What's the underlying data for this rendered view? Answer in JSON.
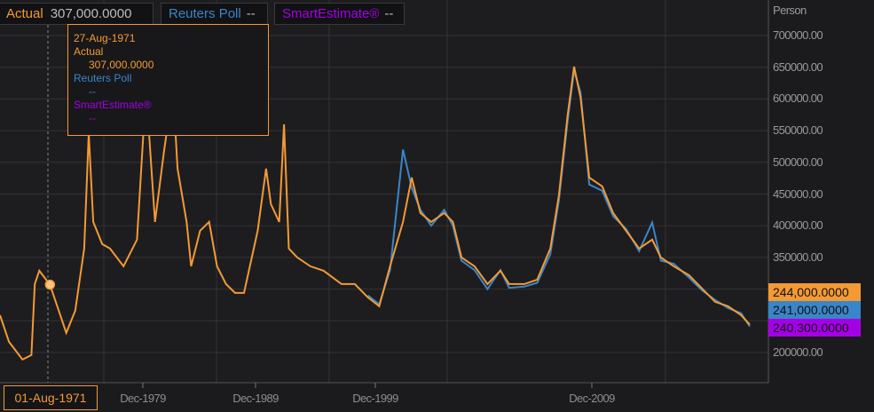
{
  "legend": {
    "actual_label": "Actual",
    "actual_value": "307,000.0000",
    "reuters_label": "Reuters Poll",
    "reuters_value": "--",
    "smart_label": "SmartEstimate®",
    "smart_value": "--"
  },
  "tooltip": {
    "date": "27-Aug-1971",
    "actual_label": "Actual",
    "actual_value": "307,000.0000",
    "reuters_label": "Reuters Poll",
    "reuters_value": "--",
    "smart_label": "SmartEstimate®",
    "smart_value": "--"
  },
  "cursor_date": "01-Aug-1971",
  "colors": {
    "actual": "#f39a35",
    "reuters": "#3a85c8",
    "smart": "#a400e6"
  },
  "chart_data": {
    "type": "line",
    "y_unit": "Person",
    "ylim": [
      150000,
      720000
    ],
    "y_ticks": [
      "700000.00",
      "650000.00",
      "600000.00",
      "550000.00",
      "500000.00",
      "450000.00",
      "400000.00",
      "350000.00",
      "200000.00"
    ],
    "x_ticks": [
      "Dec-1979",
      "Dec-1989",
      "Dec-1999",
      "Dec-2009"
    ],
    "last_values": {
      "actual": "244,000.0000",
      "reuters": "241,000.0000",
      "smart": "240,300.0000"
    },
    "series": [
      {
        "name": "Actual",
        "points": [
          [
            1967.2,
            259000
          ],
          [
            1968.0,
            217000
          ],
          [
            1969.2,
            189000
          ],
          [
            1970.0,
            196000
          ],
          [
            1970.3,
            308000
          ],
          [
            1970.7,
            329000
          ],
          [
            1971.65,
            307000
          ],
          [
            1973.1,
            231000
          ],
          [
            1973.9,
            266000
          ],
          [
            1974.7,
            364000
          ],
          [
            1975.1,
            546000
          ],
          [
            1975.5,
            406000
          ],
          [
            1976.3,
            371000
          ],
          [
            1977.0,
            364000
          ],
          [
            1978.2,
            336000
          ],
          [
            1979.4,
            378000
          ],
          [
            1980.2,
            616000
          ],
          [
            1981.0,
            406000
          ],
          [
            1981.8,
            518000
          ],
          [
            1982.6,
            616000
          ],
          [
            1983.0,
            490000
          ],
          [
            1983.8,
            406000
          ],
          [
            1984.2,
            336000
          ],
          [
            1985.0,
            392000
          ],
          [
            1985.8,
            406000
          ],
          [
            1986.5,
            336000
          ],
          [
            1987.3,
            308000
          ],
          [
            1988.1,
            294000
          ],
          [
            1988.9,
            294000
          ],
          [
            1990.1,
            392000
          ],
          [
            1990.8,
            490000
          ],
          [
            1991.2,
            434000
          ],
          [
            1991.9,
            406000
          ],
          [
            1992.3,
            560000
          ],
          [
            1992.7,
            364000
          ],
          [
            1993.4,
            350000
          ],
          [
            1994.5,
            336000
          ],
          [
            1995.6,
            329000
          ],
          [
            1997.1,
            308000
          ],
          [
            1998.2,
            308000
          ],
          [
            1999.3,
            287000
          ],
          [
            2000.1,
            273000
          ],
          [
            2000.6,
            336000
          ],
          [
            2001.2,
            406000
          ],
          [
            2001.6,
            476000
          ],
          [
            2002.0,
            420000
          ],
          [
            2002.5,
            406000
          ],
          [
            2003.1,
            420000
          ],
          [
            2003.5,
            406000
          ],
          [
            2003.9,
            350000
          ],
          [
            2004.5,
            336000
          ],
          [
            2005.1,
            308000
          ],
          [
            2005.7,
            329000
          ],
          [
            2006.1,
            308000
          ],
          [
            2006.8,
            308000
          ],
          [
            2007.4,
            315000
          ],
          [
            2008.0,
            364000
          ],
          [
            2008.4,
            448000
          ],
          [
            2008.8,
            574000
          ],
          [
            2009.1,
            651000
          ],
          [
            2009.4,
            602000
          ],
          [
            2009.8,
            476000
          ],
          [
            2010.4,
            462000
          ],
          [
            2010.9,
            420000
          ],
          [
            2011.5,
            392000
          ],
          [
            2012.1,
            364000
          ],
          [
            2012.7,
            378000
          ],
          [
            2013.1,
            350000
          ],
          [
            2013.7,
            336000
          ],
          [
            2014.4,
            322000
          ],
          [
            2015.0,
            301000
          ],
          [
            2015.6,
            280000
          ],
          [
            2016.2,
            273000
          ],
          [
            2016.8,
            259000
          ],
          [
            2017.2,
            244000
          ]
        ]
      },
      {
        "name": "Reuters Poll",
        "points": [
          [
            1999.3,
            290000
          ],
          [
            2000.1,
            276000
          ],
          [
            2000.6,
            330000
          ],
          [
            2001.2,
            520000
          ],
          [
            2001.6,
            460000
          ],
          [
            2002.0,
            425000
          ],
          [
            2002.5,
            400000
          ],
          [
            2003.1,
            425000
          ],
          [
            2003.5,
            400000
          ],
          [
            2003.9,
            345000
          ],
          [
            2004.5,
            330000
          ],
          [
            2005.1,
            300000
          ],
          [
            2005.7,
            330000
          ],
          [
            2006.1,
            302000
          ],
          [
            2006.8,
            304000
          ],
          [
            2007.4,
            310000
          ],
          [
            2008.0,
            355000
          ],
          [
            2008.4,
            440000
          ],
          [
            2008.8,
            565000
          ],
          [
            2009.1,
            645000
          ],
          [
            2009.4,
            610000
          ],
          [
            2009.8,
            465000
          ],
          [
            2010.4,
            455000
          ],
          [
            2010.9,
            415000
          ],
          [
            2011.5,
            395000
          ],
          [
            2012.1,
            360000
          ],
          [
            2012.7,
            405000
          ],
          [
            2013.1,
            345000
          ],
          [
            2013.7,
            340000
          ],
          [
            2014.4,
            318000
          ],
          [
            2015.0,
            298000
          ],
          [
            2015.6,
            283000
          ],
          [
            2016.2,
            270000
          ],
          [
            2016.8,
            262000
          ],
          [
            2017.2,
            241000
          ]
        ]
      }
    ]
  }
}
